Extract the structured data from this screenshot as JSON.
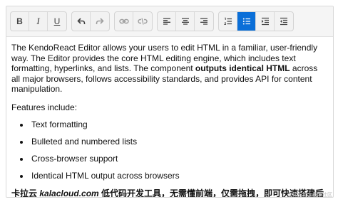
{
  "toolbar": {
    "groups": [
      [
        {
          "name": "bold-button",
          "letter": "B",
          "style": "bold"
        },
        {
          "name": "italic-button",
          "letter": "I",
          "style": "italic"
        },
        {
          "name": "underline-button",
          "letter": "U",
          "style": "underline"
        }
      ],
      [
        {
          "name": "undo-button",
          "icon": "undo-icon"
        },
        {
          "name": "redo-button",
          "icon": "redo-icon",
          "disabled": true
        }
      ],
      [
        {
          "name": "insert-link-button",
          "icon": "link-icon",
          "disabled": true
        },
        {
          "name": "unlink-button",
          "icon": "unlink-icon",
          "disabled": true
        }
      ],
      [
        {
          "name": "align-left-button",
          "icon": "align-left-icon"
        },
        {
          "name": "align-center-button",
          "icon": "align-center-icon"
        },
        {
          "name": "align-right-button",
          "icon": "align-right-icon"
        }
      ],
      [
        {
          "name": "ordered-list-button",
          "icon": "ordered-list-icon"
        },
        {
          "name": "unordered-list-button",
          "icon": "unordered-list-icon",
          "active": true
        },
        {
          "name": "indent-button",
          "icon": "indent-icon"
        },
        {
          "name": "outdent-button",
          "icon": "outdent-icon"
        }
      ]
    ],
    "active_color": "#0b6fd8"
  },
  "content": {
    "intro_before": "The KendoReact Editor allows your users to edit HTML in a familiar, user-friendly way. The Editor provides the core HTML editing engine, which includes text formatting, hyperlinks, and lists. The component ",
    "intro_bold": "outputs identical HTML",
    "intro_after": " across all major browsers, follows accessibility standards, and provides API for content manipulation.",
    "features_heading": "Features include:",
    "features": [
      "Text formatting",
      "Bulleted and numbered lists",
      "Cross-browser support",
      "Identical HTML output across browsers"
    ],
    "cn_before": "卡拉云 ",
    "cn_link": "kalacloud.com",
    "cn_after": " 低代码开发工具，无需懂前端，仅需拖拽，即可快速搭建后台管理工具。"
  },
  "watermark": "@稀土掘金技术社区"
}
